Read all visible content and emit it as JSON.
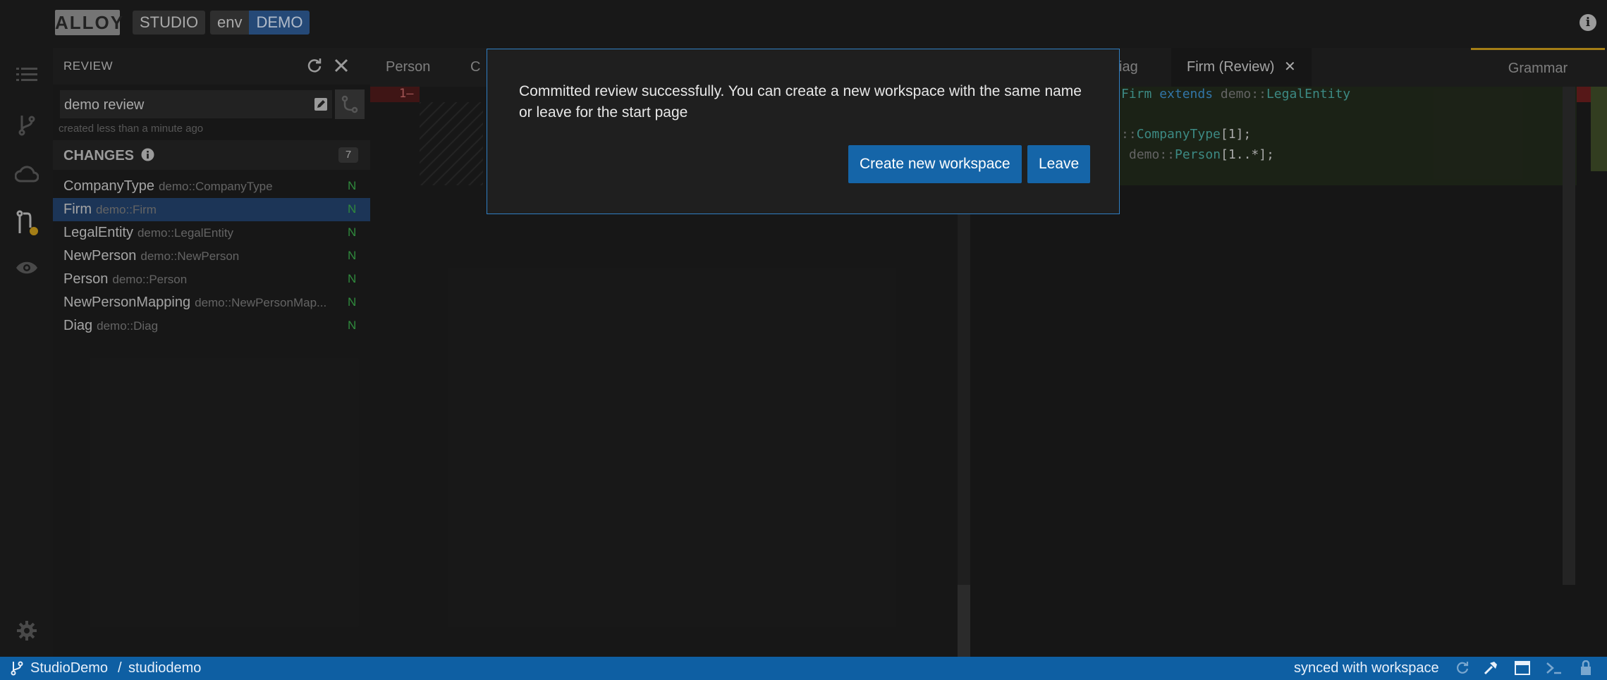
{
  "header": {
    "logo_text": "ALLOY",
    "studio_label": "STUDIO",
    "env_label": "env",
    "env_value": "DEMO"
  },
  "side_panel": {
    "title": "REVIEW",
    "review_name": "demo review",
    "created_text": "created less than a minute ago",
    "changes_title": "CHANGES",
    "changes_count": "7",
    "changes": [
      {
        "name": "CompanyType",
        "path": "demo::CompanyType",
        "status": "N"
      },
      {
        "name": "Firm",
        "path": "demo::Firm",
        "status": "N"
      },
      {
        "name": "LegalEntity",
        "path": "demo::LegalEntity",
        "status": "N"
      },
      {
        "name": "NewPerson",
        "path": "demo::NewPerson",
        "status": "N"
      },
      {
        "name": "Person",
        "path": "demo::Person",
        "status": "N"
      },
      {
        "name": "NewPersonMapping",
        "path": "demo::NewPersonMap...",
        "status": "N"
      },
      {
        "name": "Diag",
        "path": "demo::Diag",
        "status": "N"
      }
    ]
  },
  "tabs": {
    "tab1": "Person",
    "tab2": "C",
    "tab3": "iag",
    "active_tab": "Firm (Review)",
    "grammar": "Grammar"
  },
  "editor": {
    "left_line_number": "1",
    "left_line_marker": "—",
    "right_code": {
      "line1_class": "Firm",
      "line1_extends": "extends",
      "line1_ns": "demo::",
      "line1_type": "LegalEntity",
      "line3_ns": "::",
      "line3_type": "CompanyType",
      "line3_mult": "[1];",
      "line4_ns": "demo::",
      "line4_type": "Person",
      "line4_mult": "[1..*];"
    }
  },
  "modal": {
    "message": "Committed review successfully. You can create a new workspace with the same name or leave for the start page",
    "create_label": "Create new workspace",
    "leave_label": "Leave"
  },
  "status_bar": {
    "project": "StudioDemo",
    "separator": "/",
    "workspace": "studiodemo",
    "sync_text": "synced with workspace"
  },
  "colors": {
    "accent_blue": "#0e5fa3",
    "modal_border": "#2f7fc4",
    "button_blue": "#1565a8",
    "new_badge_green": "#3aa84a",
    "grammar_accent": "#c99a1c"
  }
}
